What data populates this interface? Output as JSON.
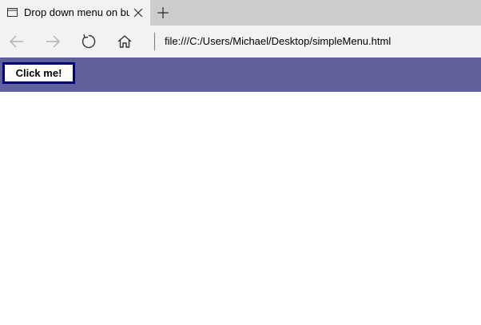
{
  "browser": {
    "tab": {
      "title": "Drop down menu on bu",
      "icon": "page-icon",
      "close_icon": "close-icon"
    },
    "new_tab_icon": "plus-icon",
    "nav": {
      "back_icon": "back-arrow-icon",
      "forward_icon": "forward-arrow-icon",
      "refresh_icon": "refresh-icon",
      "home_icon": "home-icon"
    },
    "address": "file:///C:/Users/Michael/Desktop/simpleMenu.html"
  },
  "page": {
    "header_color": "#5f5f9b",
    "button_label": "Click me!",
    "button_border_color": "#000078"
  }
}
